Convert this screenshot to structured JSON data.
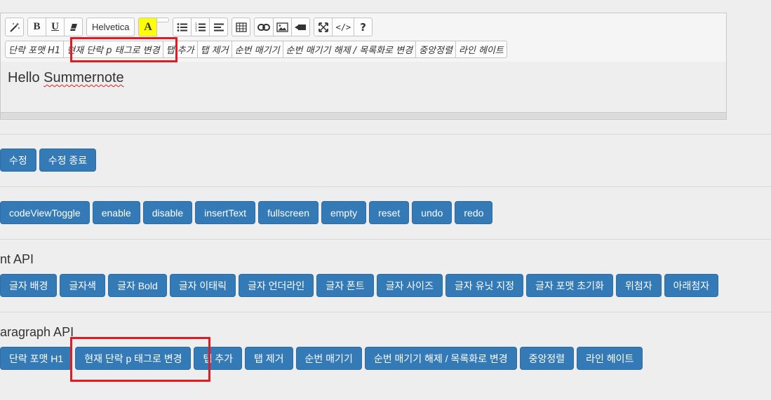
{
  "toolbar": {
    "style_icon": "magic-wand-icon",
    "bold_label": "B",
    "underline_label": "U",
    "eraser_icon": "eraser-icon",
    "font_name": "Helvetica",
    "color_label": "A",
    "color_bg": "#ffff00",
    "ul_icon": "unordered-list-icon",
    "ol_icon": "ordered-list-icon",
    "align_icon": "align-left-icon",
    "table_icon": "table-icon",
    "link_icon": "link-icon",
    "picture_icon": "picture-icon",
    "video_icon": "video-icon",
    "fullscreen_icon": "fullscreen-icon",
    "codeview_label": "</>",
    "help_label": "?",
    "custom_buttons": [
      "단락 포맷 H1",
      "현재 단락 p 태그로 변경",
      "탭 추가",
      "탭 제거",
      "순번 매기기",
      "순번 매기기 해제 / 목록화로 변경",
      "중앙정렬",
      "라인 헤이트"
    ]
  },
  "editor": {
    "content_prefix": "Hello ",
    "content_word": "Summernote"
  },
  "edit_buttons": [
    "수정",
    "수정 종료"
  ],
  "api_buttons": [
    "codeViewToggle",
    "enable",
    "disable",
    "insertText",
    "fullscreen",
    "empty",
    "reset",
    "undo",
    "redo"
  ],
  "font_section": {
    "title": "nt API",
    "buttons": [
      "글자 배경",
      "글자색",
      "글자 Bold",
      "글자 이태릭",
      "글자 언더라인",
      "글자 폰트",
      "글자 사이즈",
      "글자 유닛 지정",
      "글자 포맷 초기화",
      "위첨자",
      "아래첨자"
    ]
  },
  "paragraph_section": {
    "title": "aragraph API",
    "buttons": [
      "단락 포맷 H1",
      "현재 단락 p 태그로 변경",
      "탭 추가",
      "탭 제거",
      "순번 매기기",
      "순번 매기기 해제 / 목록화로 변경",
      "중앙정렬",
      "라인 헤이트"
    ]
  },
  "colors": {
    "primary_button": "#337ab7",
    "highlight": "#e01b24"
  }
}
